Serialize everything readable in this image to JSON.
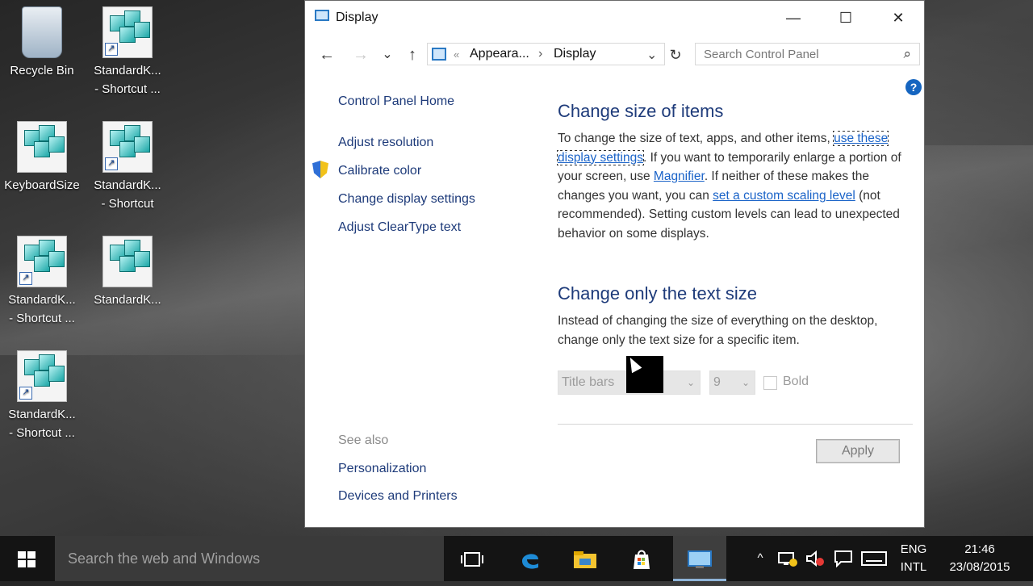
{
  "desktop": {
    "icons": [
      {
        "label": "Recycle Bin",
        "icon": "recycle-bin-icon"
      },
      {
        "label": "StandardK...\n- Shortcut ...",
        "icon": "registry-shortcut-icon"
      },
      {
        "label": "KeyboardSize",
        "icon": "registry-file-icon"
      },
      {
        "label": "StandardK...\n- Shortcut",
        "icon": "registry-shortcut-icon"
      },
      {
        "label": "StandardK...\n- Shortcut ...",
        "icon": "registry-shortcut-icon"
      },
      {
        "label": "StandardK...",
        "icon": "registry-file-icon"
      },
      {
        "label": "StandardK...\n- Shortcut ...",
        "icon": "registry-shortcut-icon"
      }
    ]
  },
  "window": {
    "title": "Display",
    "controls": {
      "minimize": "—",
      "maximize": "☐",
      "close": "✕"
    },
    "nav": {
      "back": "←",
      "forward": "→",
      "recent": "⌄",
      "up": "↑",
      "refresh": "↻",
      "dropdown": "⌄"
    },
    "address": {
      "sep1": "«",
      "crumb1": "Appeara...",
      "sep2": "›",
      "crumb2": "Display"
    },
    "search": {
      "placeholder": "Search Control Panel",
      "icon": "⌕"
    },
    "help": "?",
    "sidebar": {
      "home": "Control Panel Home",
      "items": [
        "Adjust resolution",
        "Calibrate color",
        "Change display settings",
        "Adjust ClearType text"
      ],
      "see_also": "See also",
      "see_also_items": [
        "Personalization",
        "Devices and Printers"
      ]
    },
    "main": {
      "heading1": "Change size of items",
      "p1_a": "To change the size of text, apps, and other items,",
      "link1a": "use these",
      "link1b": "display settings",
      "p1_b": ". If you want to temporarily enlarge a portion of your screen, use",
      "link2": "Magnifier",
      "p1_c": ". If neither of these makes the changes you want, you can",
      "link3a": "set a custom scaling",
      "link3b": "level",
      "p1_d": "(not recommended). Setting custom levels can lead to unexpected behavior on some displays.",
      "heading2": "Change only the text size",
      "p2": "Instead of changing the size of everything on the desktop, change only the text size for a specific item.",
      "item_select": "Title bars",
      "size_select": "9",
      "bold_label": "Bold",
      "bold_checked": false,
      "apply": "Apply"
    }
  },
  "taskbar": {
    "search_placeholder": "Search the web and Windows",
    "lang_top": "ENG",
    "lang_bottom": "INTL",
    "time": "21:46",
    "date": "23/08/2015",
    "tray_up": "^"
  }
}
